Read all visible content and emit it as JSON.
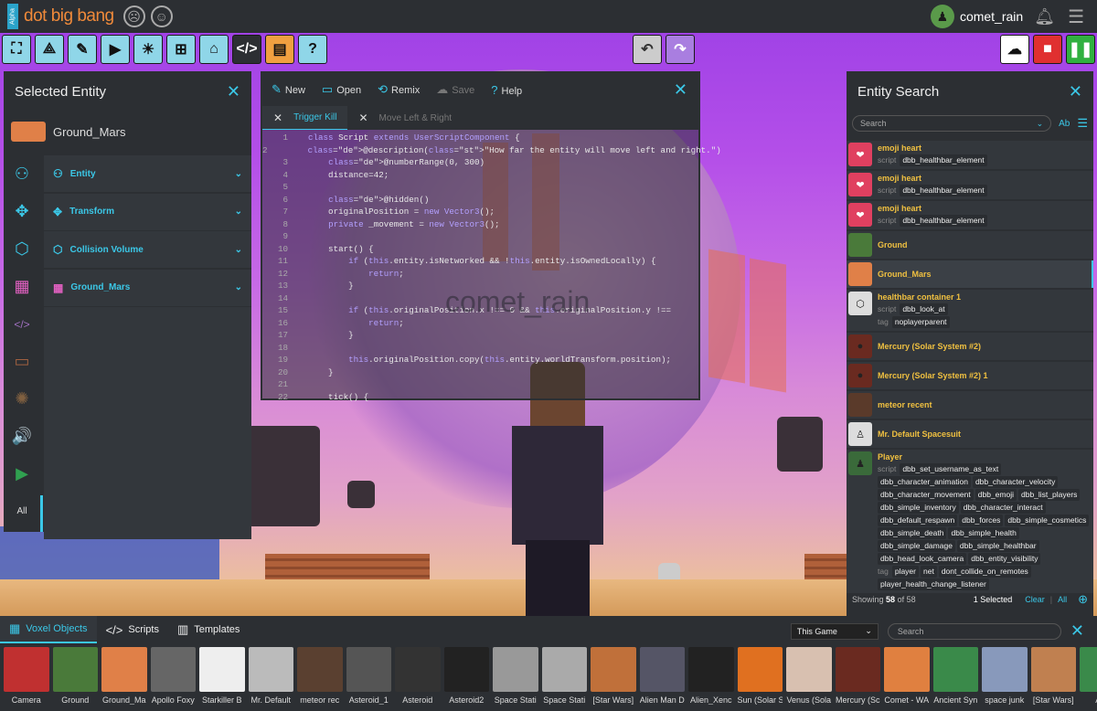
{
  "app": {
    "logo": "dot big bang",
    "tag": "Alpha"
  },
  "user": {
    "name": "comet_rain"
  },
  "toolbar": {
    "left": [
      "select-icon",
      "share-icon",
      "edit-icon",
      "camera-icon",
      "light-icon",
      "hierarchy-icon",
      "snapshot-icon",
      "code-icon",
      "asset-icon",
      "help-icon"
    ],
    "left_glyphs": [
      "⛶",
      "⟁",
      "✎",
      "▶",
      "☀",
      "⊞",
      "⌂",
      "</>",
      "▤",
      "?"
    ],
    "undo": "↶",
    "redo": "↷",
    "right_glyphs": [
      "☁",
      "■",
      "❚❚"
    ]
  },
  "selected_entity": {
    "title": "Selected Entity",
    "name": "Ground_Mars",
    "side_icons": [
      "⚇",
      "✥",
      "⬡",
      "▦",
      "</>",
      "▭",
      "✺",
      "🔊",
      "▶"
    ],
    "side_all": "All",
    "sections": [
      {
        "label": "Entity",
        "icon": "⚇"
      },
      {
        "label": "Transform",
        "icon": "✥"
      },
      {
        "label": "Collision Volume",
        "icon": "⬡"
      },
      {
        "label": "Ground_Mars",
        "icon": "▦"
      }
    ]
  },
  "editor": {
    "actions": [
      {
        "label": "New",
        "icon": "✎"
      },
      {
        "label": "Open",
        "icon": "▭"
      },
      {
        "label": "Remix",
        "icon": "⟲"
      },
      {
        "label": "Save",
        "icon": "☁"
      },
      {
        "label": "Help",
        "icon": "?"
      }
    ],
    "tabs": [
      "Trigger Kill",
      "Move Left & Right"
    ],
    "watermark": "comet_rain",
    "lines": [
      "class Script extends UserScriptComponent {",
      "    @description(\"How far the entity will move left and right.\")",
      "    @numberRange(0, 300)",
      "    distance=42;",
      "",
      "    @hidden()",
      "    originalPosition = new Vector3();",
      "    private _movement = new Vector3();",
      "",
      "    start() {",
      "        if (this.entity.isNetworked && !this.entity.isOwnedLocally) {",
      "            return;",
      "        }",
      "",
      "        if (this.originalPosition.x !== 0 && this.originalPosition.y !==",
      "            return;",
      "        }",
      "",
      "        this.originalPosition.copy(this.entity.worldTransform.position);",
      "    }",
      "",
      "    tick() {"
    ]
  },
  "entity_search": {
    "title": "Entity Search",
    "placeholder": "Search",
    "entities": [
      {
        "name": "emoji heart",
        "script": [
          "dbb_healthbar_element"
        ],
        "tag": [],
        "thumb": "#e04060",
        "glyph": "❤"
      },
      {
        "name": "emoji heart",
        "script": [
          "dbb_healthbar_element"
        ],
        "tag": [],
        "thumb": "#e04060",
        "glyph": "❤"
      },
      {
        "name": "emoji heart",
        "script": [
          "dbb_healthbar_element"
        ],
        "tag": [],
        "thumb": "#e04060",
        "glyph": "❤"
      },
      {
        "name": "Ground",
        "script": [],
        "tag": [],
        "thumb": "#4a7a3a",
        "glyph": ""
      },
      {
        "name": "Ground_Mars",
        "script": [],
        "tag": [],
        "thumb": "#e08048",
        "glyph": "",
        "selected": true
      },
      {
        "name": "healthbar container 1",
        "script": [
          "dbb_look_at"
        ],
        "tag": [
          "noplayerparent"
        ],
        "thumb": "#ddd",
        "glyph": "⬡"
      },
      {
        "name": "Mercury (Solar System #2)",
        "script": [],
        "tag": [],
        "thumb": "#6a2a20",
        "glyph": "●"
      },
      {
        "name": "Mercury (Solar System #2) 1",
        "script": [],
        "tag": [],
        "thumb": "#6a2a20",
        "glyph": "●"
      },
      {
        "name": "meteor recent",
        "script": [],
        "tag": [],
        "thumb": "#5a3a2a",
        "glyph": ""
      },
      {
        "name": "Mr. Default Spacesuit",
        "script": [],
        "tag": [],
        "thumb": "#ddd",
        "glyph": "♙"
      },
      {
        "name": "Player",
        "script": [
          "dbb_set_username_as_text",
          "dbb_character_animation",
          "dbb_character_velocity",
          "dbb_character_movement",
          "dbb_emoji",
          "dbb_list_players",
          "dbb_simple_inventory",
          "dbb_character_interact",
          "dbb_default_respawn",
          "dbb_forces",
          "dbb_simple_cosmetics",
          "dbb_simple_death",
          "dbb_simple_health",
          "dbb_simple_damage",
          "dbb_simple_healthbar",
          "dbb_head_look_camera",
          "dbb_entity_visibility"
        ],
        "tag": [
          "player",
          "net",
          "dont_collide_on_remotes",
          "player_health_change_listener"
        ],
        "thumb": "#3a6a3a",
        "glyph": "♟"
      }
    ],
    "footer": {
      "showing_prefix": "Showing",
      "shown": "58",
      "of": "of",
      "total": "58",
      "selected": "1 Selected",
      "clear": "Clear",
      "all": "All"
    },
    "labels": {
      "script": "script",
      "tag": "tag"
    }
  },
  "bottom": {
    "tabs": [
      {
        "label": "Voxel Objects",
        "icon": "▦"
      },
      {
        "label": "Scripts",
        "icon": "</>"
      },
      {
        "label": "Templates",
        "icon": "▥"
      }
    ],
    "filter": "This Game",
    "search_placeholder": "Search",
    "items": [
      {
        "label": "Camera",
        "color": "#c03030"
      },
      {
        "label": "Ground",
        "color": "#4a7a3a"
      },
      {
        "label": "Ground_Ma",
        "color": "#e08048"
      },
      {
        "label": "Apollo Foxy",
        "color": "#666"
      },
      {
        "label": "Starkiller B",
        "color": "#eee"
      },
      {
        "label": "Mr. Default",
        "color": "#bbb"
      },
      {
        "label": "meteor rec",
        "color": "#5a4030"
      },
      {
        "label": "Asteroid_1",
        "color": "#555"
      },
      {
        "label": "Asteroid",
        "color": "#333"
      },
      {
        "label": "Asteroid2",
        "color": "#222"
      },
      {
        "label": "Space Stati",
        "color": "#999"
      },
      {
        "label": "Space Stati",
        "color": "#aaa"
      },
      {
        "label": "[Star Wars]",
        "color": "#c0703a"
      },
      {
        "label": "Alien Man D",
        "color": "#556"
      },
      {
        "label": "Alien_Xenc",
        "color": "#222"
      },
      {
        "label": "Sun (Solar S",
        "color": "#e07020"
      },
      {
        "label": "Venus (Sola",
        "color": "#d8c0b0"
      },
      {
        "label": "Mercury (Sc",
        "color": "#6a2a20"
      },
      {
        "label": "Comet - WA",
        "color": "#e08040"
      },
      {
        "label": "Ancient Syn",
        "color": "#3a8a4a"
      },
      {
        "label": "space junk",
        "color": "#8899bb"
      },
      {
        "label": "[Star Wars]",
        "color": "#c08050"
      },
      {
        "label": "Alie",
        "color": "#3a8a4a"
      }
    ]
  }
}
